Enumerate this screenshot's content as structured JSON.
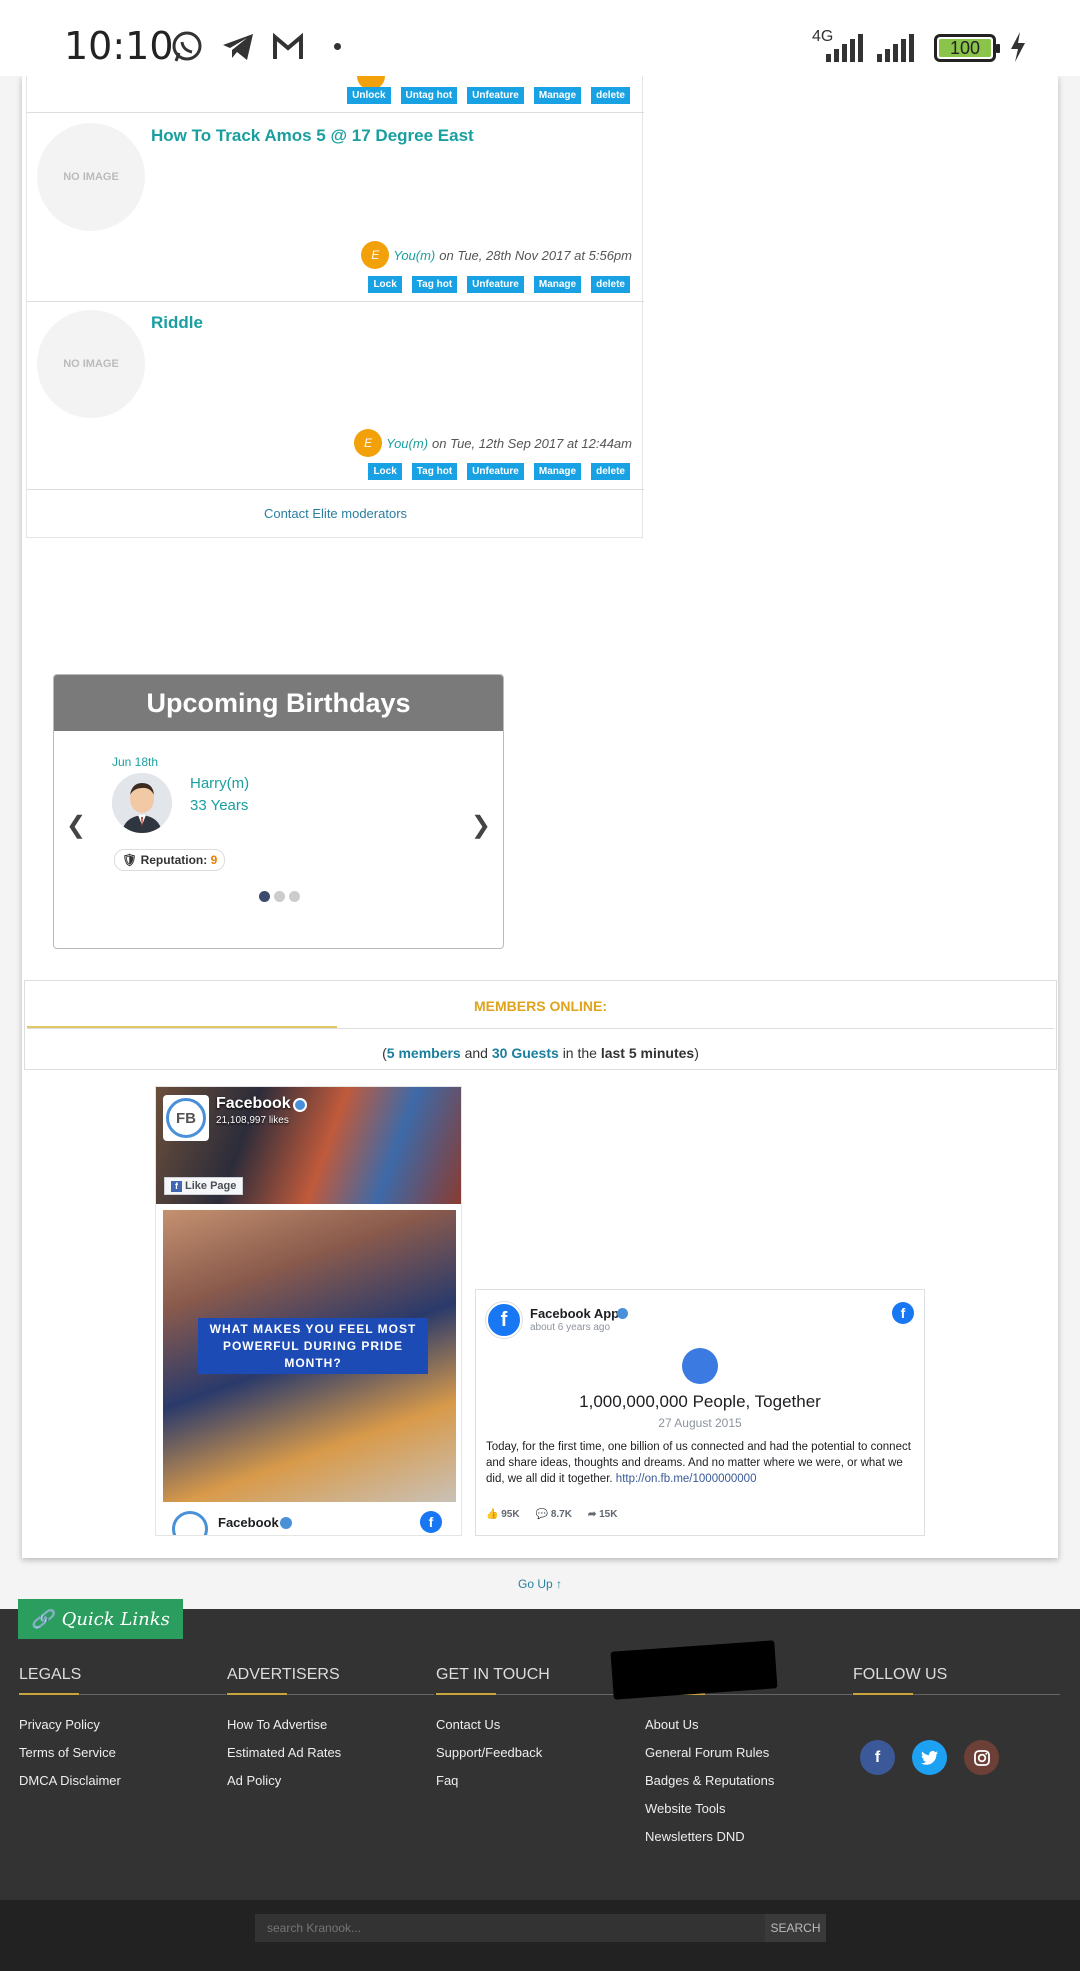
{
  "status_bar": {
    "time": "10:10",
    "network": "4G",
    "battery": "100",
    "icons": [
      "whatsapp-icon",
      "telegram-icon",
      "gmail-icon",
      "dot-icon",
      "signal-icon",
      "signal-icon",
      "battery-icon",
      "charging-icon"
    ]
  },
  "threads": {
    "top_buttons": [
      "Unlock",
      "Untag hot",
      "Unfeature",
      "Manage",
      "delete"
    ],
    "items": [
      {
        "image": "NO IMAGE",
        "title": "How To Track Amos 5 @ 17 Degree East",
        "avatar": "E",
        "author": "You(m)",
        "date": "on Tue, 28th Nov 2017 at 5:56pm",
        "buttons": [
          "Lock",
          "Tag hot",
          "Unfeature",
          "Manage",
          "delete"
        ]
      },
      {
        "image": "NO IMAGE",
        "title": "Riddle",
        "avatar": "E",
        "author": "You(m)",
        "date": "on Tue, 12th Sep 2017 at 12:44am",
        "buttons": [
          "Lock",
          "Tag hot",
          "Unfeature",
          "Manage",
          "delete"
        ]
      }
    ],
    "contact": "Contact Elite moderators"
  },
  "birthdays": {
    "title": "Upcoming Birthdays",
    "date": "Jun 18th",
    "name": "Harry(m)",
    "age": "33 Years",
    "rep_label": "Reputation:",
    "rep_value": "9",
    "prev": "❮",
    "next": "❯"
  },
  "members": {
    "label": "MEMBERS ONLINE:",
    "open": "(",
    "members": "5 members",
    "and": "and",
    "guests": "30 Guests",
    "in_the": "in the",
    "period": "last 5 minutes",
    "close": ")"
  },
  "fb_page": {
    "logo": "FB",
    "name": "Facebook",
    "likes": "21,108,997 likes",
    "like_button": "Like Page",
    "banner": "WHAT MAKES YOU FEEL MOST POWERFUL DURING PRIDE MONTH?",
    "footer_name": "Facebook"
  },
  "fb_post": {
    "name": "Facebook App",
    "time": "about 6 years ago",
    "headline": "1,000,000,000 People, Together",
    "date": "27 August 2015",
    "text": "Today, for the first time, one billion of us connected and had the potential to connect and share ideas, thoughts and dreams. And no matter where we were, or what we did, we all did it together.",
    "link": "http://on.fb.me/1000000000",
    "likes": "95K",
    "comments": "8.7K",
    "shares": "15K"
  },
  "go_up": "Go Up ↑",
  "footer": {
    "quick_links": "Quick Links",
    "columns": [
      {
        "title": "LEGALS",
        "items": [
          "Privacy Policy",
          "Terms of Service",
          "DMCA Disclaimer"
        ]
      },
      {
        "title": "ADVERTISERS",
        "items": [
          "How To Advertise",
          "Estimated Ad Rates",
          "Ad Policy"
        ]
      },
      {
        "title": "GET IN TOUCH",
        "items": [
          "Contact Us",
          "Support/Feedback",
          "Faq"
        ]
      },
      {
        "title": "",
        "items": [
          "About Us",
          "General Forum Rules",
          "Badges & Reputations",
          "Website Tools",
          "Newsletters DND"
        ]
      },
      {
        "title": "FOLLOW US",
        "items": []
      }
    ],
    "social": [
      "facebook-icon",
      "twitter-icon",
      "instagram-icon"
    ],
    "search_placeholder": "search Kranook...",
    "search_button": "SEARCH"
  }
}
